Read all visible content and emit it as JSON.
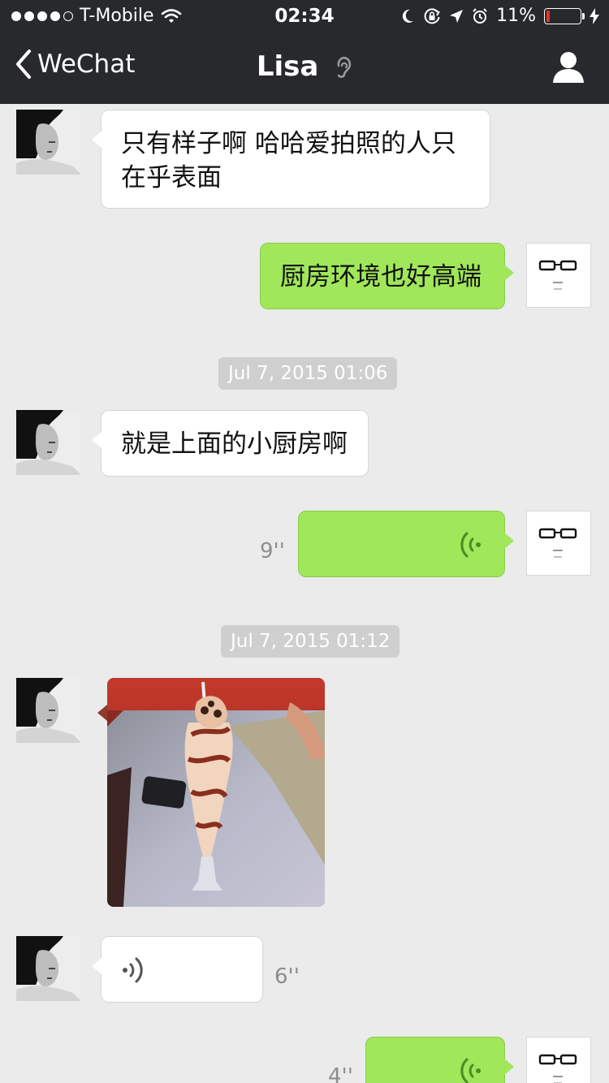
{
  "status_bar": {
    "carrier": "T-Mobile",
    "time": "02:34",
    "battery_percent": "11%",
    "battery_level": 0.11,
    "signal_bars": 4,
    "icons": [
      "wifi-icon",
      "moon-icon",
      "rotation-lock-icon",
      "location-arrow-icon",
      "alarm-icon",
      "charging-bolt-icon"
    ]
  },
  "nav": {
    "back_label": "WeChat",
    "title": "Lisa",
    "icons": [
      "back-chevron-icon",
      "earpiece-mode-icon",
      "profile-icon"
    ]
  },
  "messages": [
    {
      "from": "lisa",
      "type": "text",
      "text_line1": "只有样子啊 哈哈爱拍照的人只",
      "text_line2": "在乎表面"
    },
    {
      "from": "me",
      "type": "text",
      "text": "厨房环境也好高端"
    },
    {
      "type": "timestamp",
      "text": "Jul 7, 2015 01:06"
    },
    {
      "from": "lisa",
      "type": "text",
      "text": "就是上面的小厨房啊"
    },
    {
      "from": "me",
      "type": "voice",
      "duration": "9''"
    },
    {
      "type": "timestamp",
      "text": "Jul 7, 2015 01:12"
    },
    {
      "from": "lisa",
      "type": "image",
      "subject": "sundae-photo"
    },
    {
      "from": "lisa",
      "type": "voice",
      "duration": "6''"
    },
    {
      "from": "me",
      "type": "voice",
      "duration": "4''"
    }
  ],
  "colors": {
    "nav_background": "#28292d",
    "chat_background": "#ebebeb",
    "outgoing_bubble": "#a0e75a",
    "incoming_bubble": "#ffffff",
    "timestamp_pill": "#cfcfcf",
    "battery_low": "#e3342b"
  }
}
